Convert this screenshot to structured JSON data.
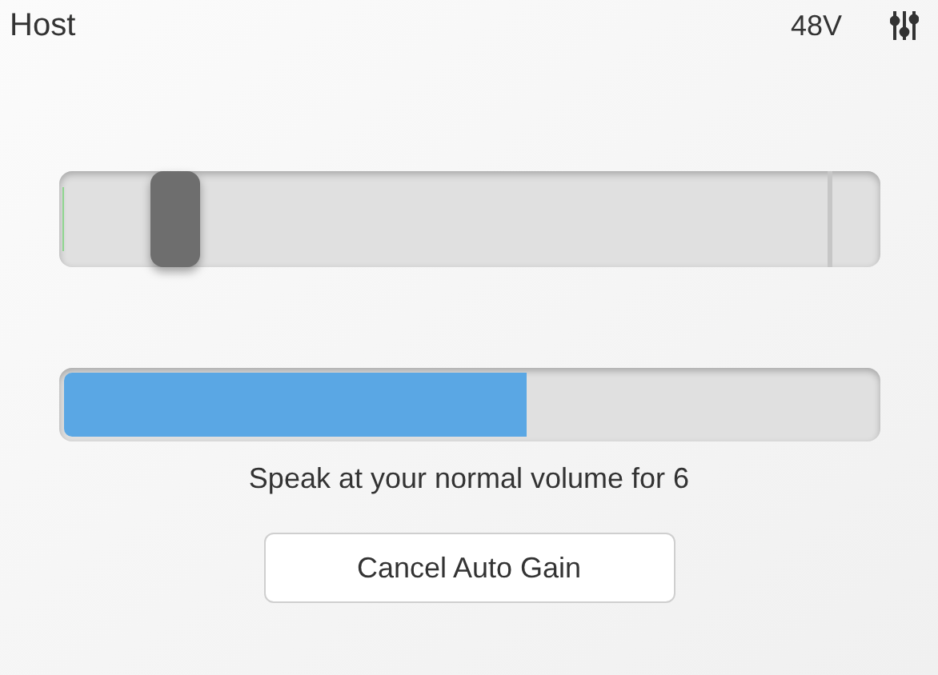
{
  "header": {
    "title": "Host",
    "phantom_power": "48V"
  },
  "gain_slider": {
    "level": 0.14
  },
  "threshold": {
    "level": 0.935
  },
  "progress": {
    "level": 0.571,
    "message": "Speak at your normal volume for 6"
  },
  "buttons": [
    "Cancel Auto Gain"
  ]
}
